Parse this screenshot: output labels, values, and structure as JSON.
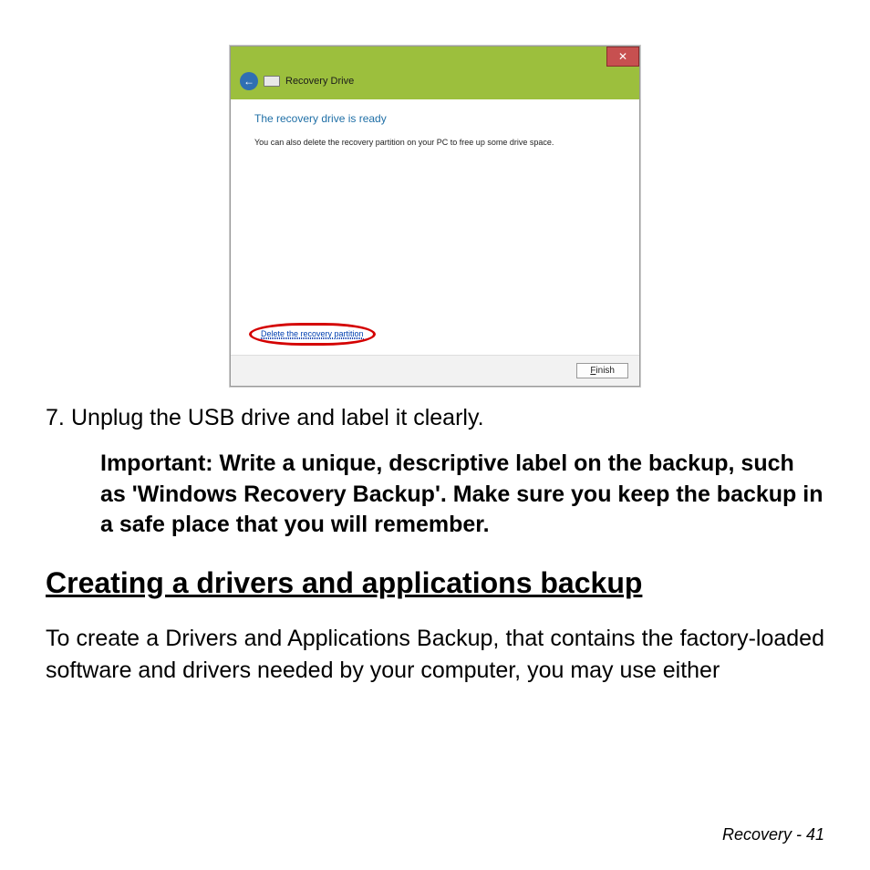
{
  "dialog": {
    "window_title": "Recovery Drive",
    "heading": "The recovery drive is ready",
    "subtext": "You can also delete the recovery partition on your PC to free up some drive space.",
    "delete_link": "Delete the recovery partition",
    "finish_prefix": "F",
    "finish_rest": "inish"
  },
  "step": {
    "number": "7.",
    "text": "Unplug the USB drive and label it clearly."
  },
  "important": "Important: Write a unique, descriptive label on the backup, such as 'Windows Recovery Backup'. Make sure you keep the backup in a safe place that you will remember.",
  "section": {
    "heading": "Creating a drivers and applications backup",
    "body": "To create a Drivers and Applications Backup, that contains the factory-loaded software and drivers needed by your computer, you may use either"
  },
  "footer": "Recovery -  41"
}
